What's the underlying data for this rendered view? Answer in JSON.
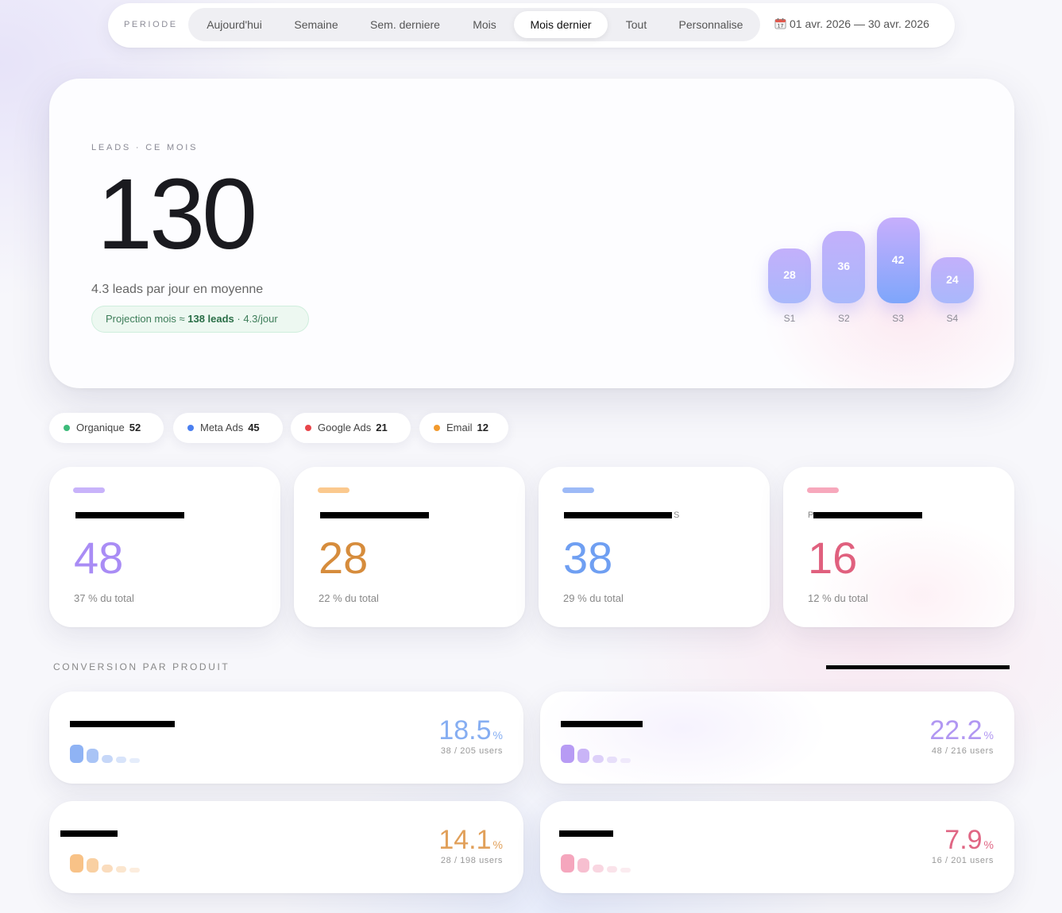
{
  "period": {
    "label": "PERIODE",
    "tabs": [
      "Aujourd'hui",
      "Semaine",
      "Sem. derniere",
      "Mois",
      "Mois dernier",
      "Tout",
      "Personnalise"
    ],
    "active_tab": "Mois dernier",
    "date_range": "01 avr. 2026 — 30 avr. 2026",
    "calendar_icon": "calendar-icon"
  },
  "hero": {
    "label": "LEADS · CE MOIS",
    "value": "130",
    "subtitle": "4.3 leads par jour en moyenne",
    "projection_prefix": "Projection mois ≈ ",
    "projection_value": "138 leads",
    "projection_suffix": " · 4.3/jour"
  },
  "chart_data": {
    "type": "bar",
    "categories": [
      "S1",
      "S2",
      "S3",
      "S4"
    ],
    "values": [
      28,
      36,
      42,
      24
    ],
    "title": "",
    "xlabel": "",
    "ylabel": ""
  },
  "sources": [
    {
      "name": "Organique",
      "value": "52",
      "color": "#3dbb7a"
    },
    {
      "name": "Meta Ads",
      "value": "45",
      "color": "#4a7ff0"
    },
    {
      "name": "Google Ads",
      "value": "21",
      "color": "#e8454a"
    },
    {
      "name": "Email",
      "value": "12",
      "color": "#f29a2e"
    }
  ],
  "stats": [
    {
      "title": "",
      "value": "48",
      "sub": "37 % du total",
      "color": "#a98cf5",
      "accent": "#c8b3fa"
    },
    {
      "title": "",
      "value": "28",
      "sub": "22 % du total",
      "color": "#d68c3c",
      "accent": "#fbc98e"
    },
    {
      "title": "S",
      "value": "38",
      "sub": "29 % du total",
      "color": "#6f9ff2",
      "accent": "#9dbaf7"
    },
    {
      "title": "P",
      "value": "16",
      "sub": "12 % du total",
      "color": "#e0607e",
      "accent": "#f7a8bc"
    }
  ],
  "conversion": {
    "label": "CONVERSION PAR PRODUIT",
    "products": [
      {
        "name": "",
        "rate": "18.5",
        "pct": "%",
        "users": "38 / 205 users",
        "color": "#86aef2",
        "dots": [
          "#8fb3f4",
          "#a9c4f6",
          "#c6d7f8",
          "#d8e4fa",
          "#e5edfb"
        ]
      },
      {
        "name": "",
        "rate": "22.2",
        "pct": "%",
        "users": "48 / 216 users",
        "color": "#b197f2",
        "dots": [
          "#b79bf4",
          "#c9b4f7",
          "#ddd0f9",
          "#e7dffa",
          "#efe9fb"
        ]
      },
      {
        "name": "",
        "rate": "14.1",
        "pct": "%",
        "users": "28 / 198 users",
        "color": "#e1a05a",
        "dots": [
          "#f8c287",
          "#f9d0a2",
          "#fadcbd",
          "#fbe6cf",
          "#fcedde"
        ]
      },
      {
        "name": "",
        "rate": "7.9",
        "pct": "%",
        "users": "16 / 201 users",
        "color": "#e06684",
        "dots": [
          "#f5a6bd",
          "#f7bfd0",
          "#f9d6e1",
          "#fae3ea",
          "#fbecf0"
        ]
      }
    ]
  }
}
